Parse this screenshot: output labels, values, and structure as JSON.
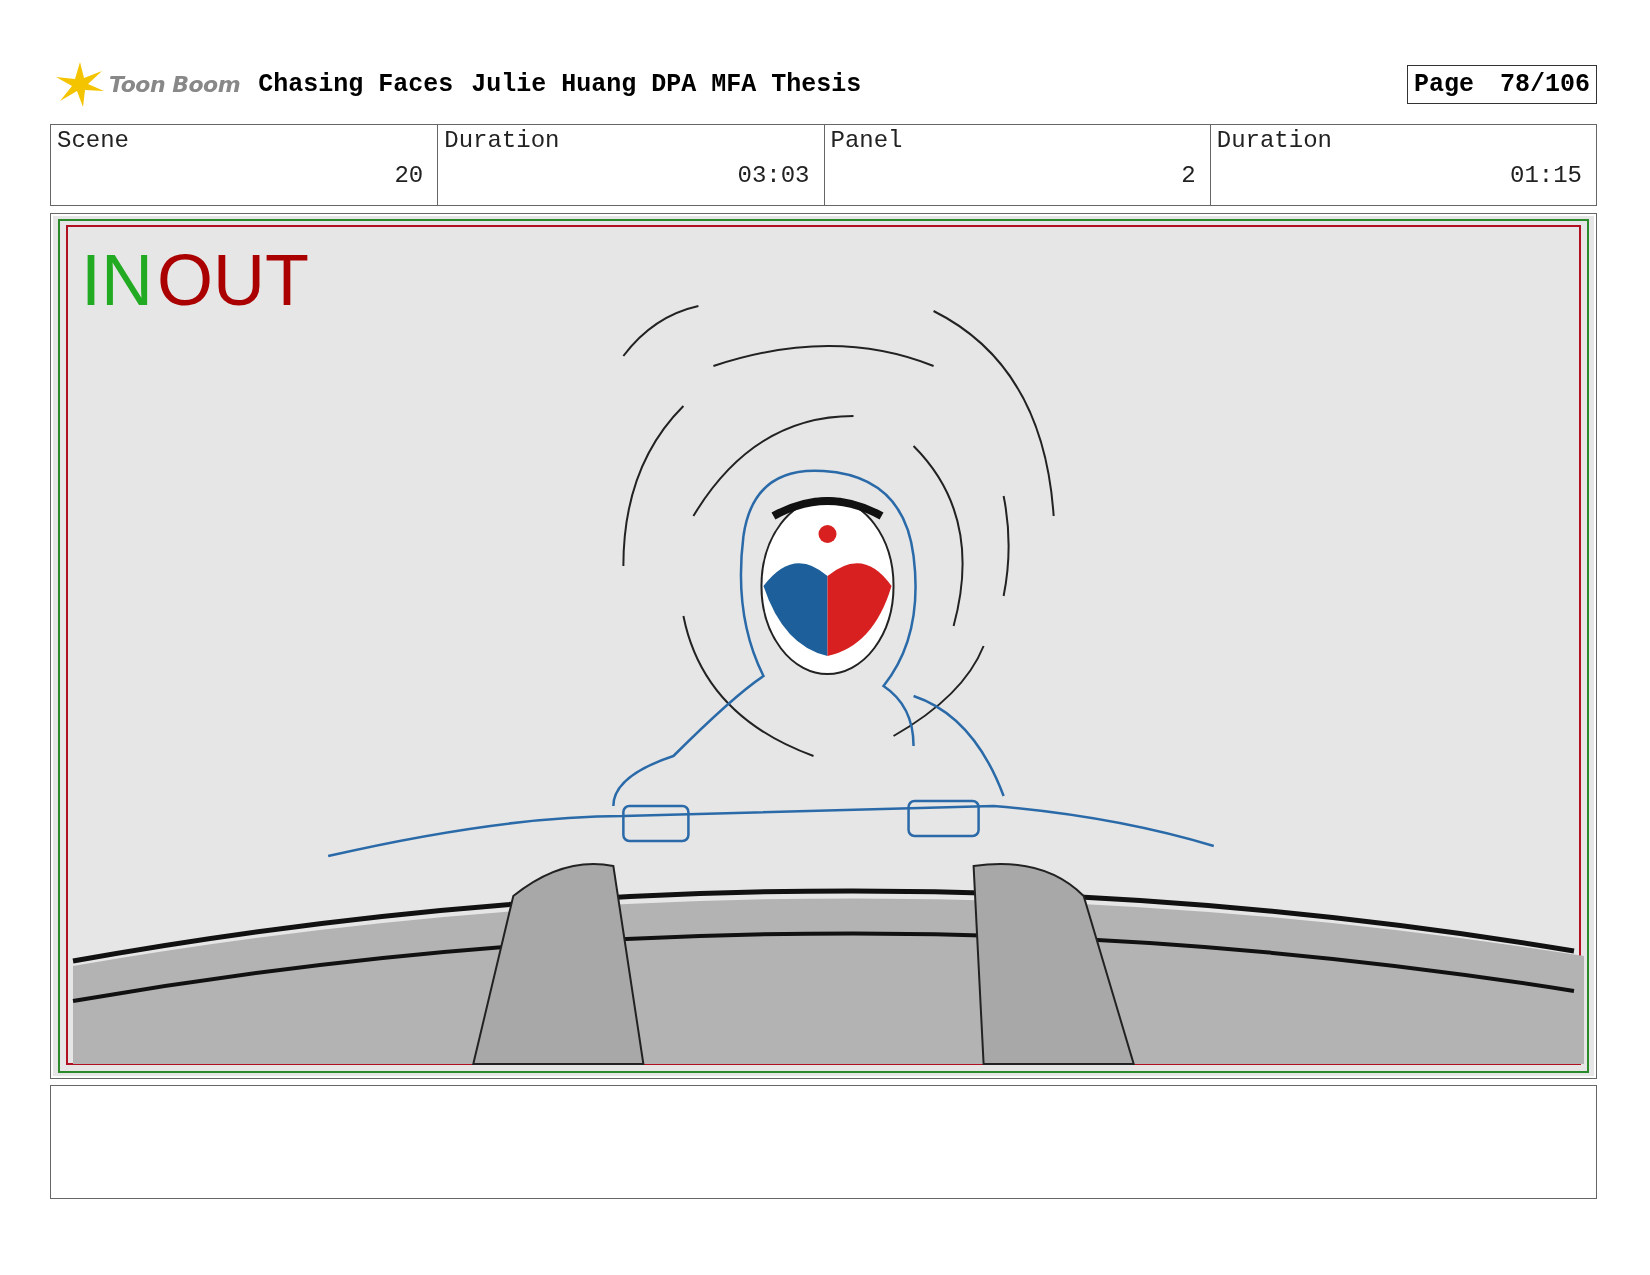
{
  "logo": {
    "text": "Toon Boom"
  },
  "header": {
    "title": "Chasing Faces",
    "subtitle": "Julie Huang DPA MFA Thesis",
    "page_label": "Page",
    "page_number": "78/106"
  },
  "info": [
    {
      "label": "Scene",
      "value": "20"
    },
    {
      "label": "Duration",
      "value": "03:03"
    },
    {
      "label": "Panel",
      "value": "2"
    },
    {
      "label": "Duration",
      "value": "01:15"
    }
  ],
  "panel": {
    "in_marker": "IN",
    "out_marker": "OUT"
  }
}
